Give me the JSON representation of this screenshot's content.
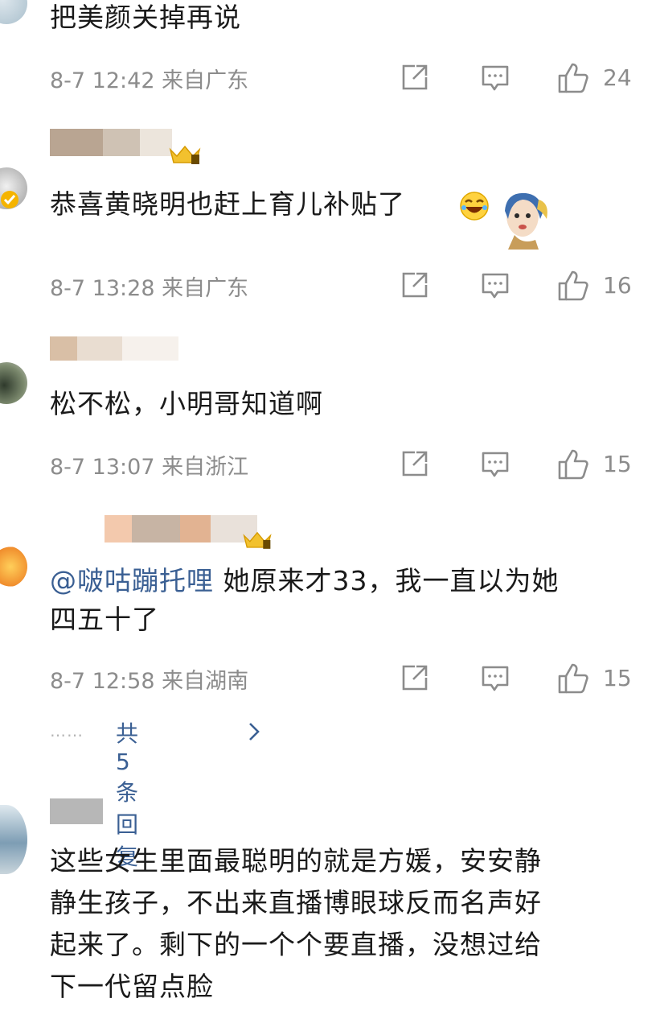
{
  "comments": [
    {
      "text": "把美颜关掉再说",
      "meta": "8-7 12:42 来自广东",
      "likes": "24"
    },
    {
      "text": "恭喜黄晓明也赶上育儿补贴了",
      "meta": "8-7 13:28 来自广东",
      "likes": "16"
    },
    {
      "text": "松不松，小明哥知道啊",
      "meta": "8-7 13:07 来自浙江",
      "likes": "15"
    },
    {
      "mention": "@啵咕蹦托哩",
      "text_line1": " 她原来才33，我一直以为她",
      "text_line2": "四五十了",
      "meta": "8-7 12:58 来自湖南",
      "likes": "15",
      "replies_label": "共5条回复",
      "replies_dots": "……"
    },
    {
      "text_lines": [
        "这些女生里面最聪明的就是方媛，安安静",
        "静生孩子，不出来直播博眼球反而名声好",
        "起来了。剩下的一个个要直播，没想过给",
        "下一代留点脸"
      ]
    }
  ],
  "icons": {
    "share": "share-icon",
    "comment": "comment-icon",
    "like": "thumbs-up-icon",
    "verified": "verified-badge-icon",
    "crown": "crown-badge-icon",
    "chevron": "chevron-right-icon"
  },
  "colors": {
    "mention": "#3a5f93",
    "meta": "#8c8c8c",
    "verified": "#f5b400"
  }
}
